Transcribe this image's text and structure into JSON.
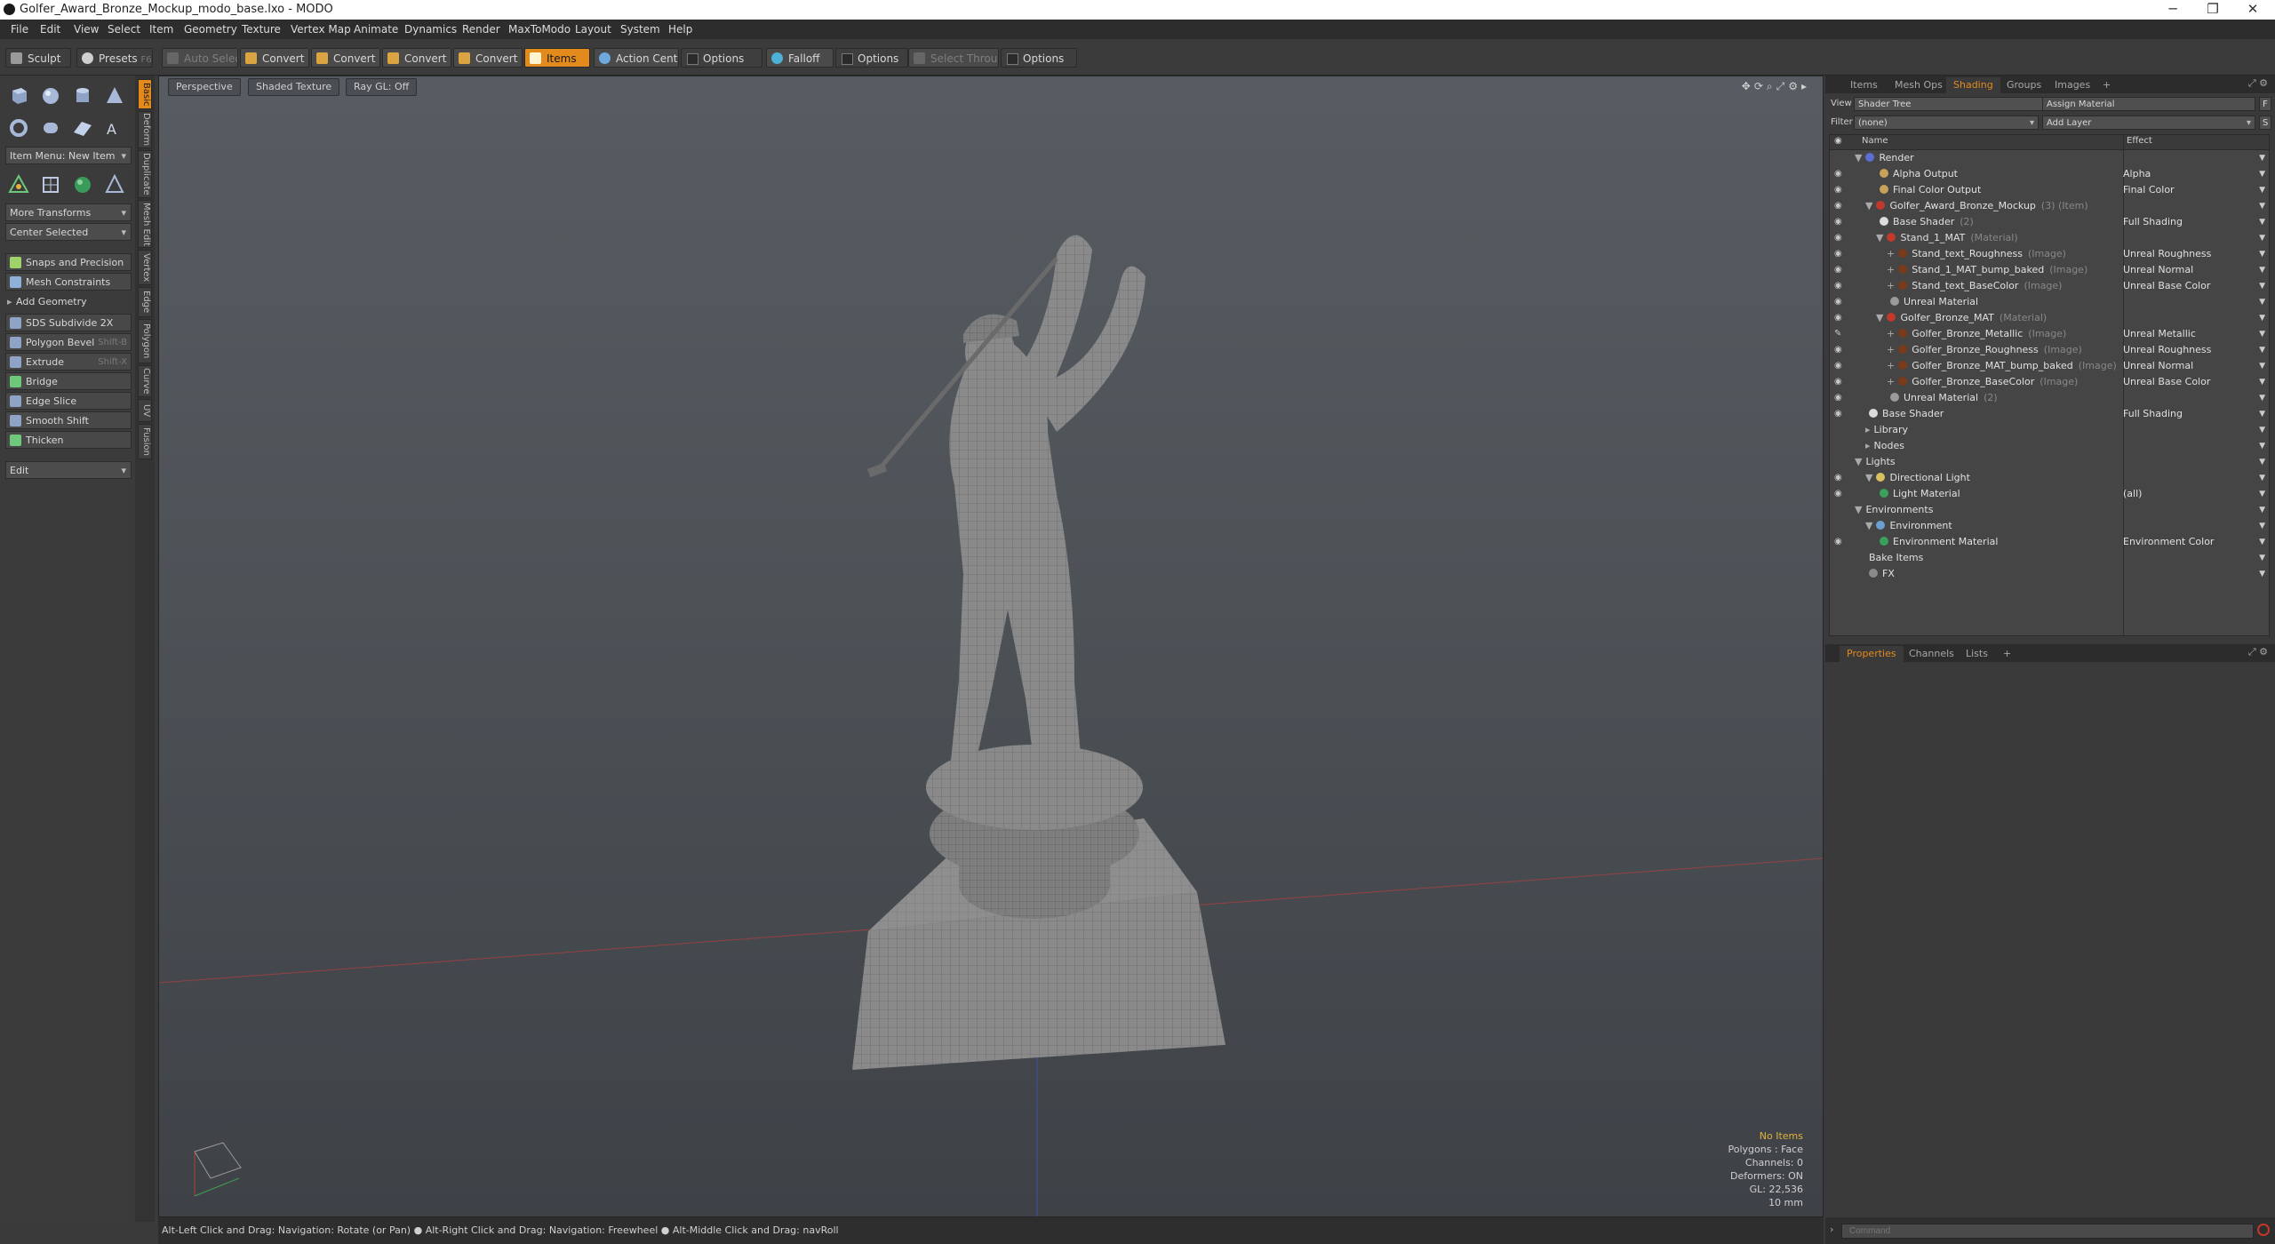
{
  "window": {
    "title": "Golfer_Award_Bronze_Mockup_modo_base.lxo - MODO"
  },
  "menu": [
    "File",
    "Edit",
    "View",
    "Select",
    "Item",
    "Geometry",
    "Texture",
    "Vertex Map",
    "Animate",
    "Dynamics",
    "Render",
    "MaxToModo",
    "Layout",
    "System",
    "Help"
  ],
  "toolbar": {
    "sculpt": "Sculpt",
    "presets": "Presets",
    "presets_key": "F6",
    "auto_select": "Auto Select",
    "convert1": "Convert",
    "convert2": "Convert",
    "convert3": "Convert",
    "convert4": "Convert",
    "items": "Items",
    "action_center": "Action Center",
    "options1": "Options",
    "falloff": "Falloff",
    "options2": "Options",
    "select_through": "Select Through",
    "options3": "Options"
  },
  "left": {
    "item_menu": "Item Menu: New Item",
    "more_transforms": "More Transforms",
    "center_selected": "Center Selected",
    "snaps": "Snaps and Precision",
    "mesh_constraints": "Mesh Constraints",
    "add_geometry": "Add Geometry",
    "sds": "SDS Subdivide 2X",
    "polygon_bevel": "Polygon Bevel",
    "polygon_bevel_key": "Shift-B",
    "extrude": "Extrude",
    "extrude_key": "Shift-X",
    "bridge": "Bridge",
    "edge_slice": "Edge Slice",
    "smooth_shift": "Smooth Shift",
    "thicken": "Thicken",
    "edit": "Edit"
  },
  "vtabs": [
    "Basic",
    "Deform",
    "Duplicate",
    "Mesh Edit",
    "Vertex",
    "Edge",
    "Polygon",
    "Curve",
    "UV",
    "Fusion"
  ],
  "viewport": {
    "perspective": "Perspective",
    "shaded": "Shaded Texture",
    "raygl": "Ray GL: Off",
    "info": {
      "no_items": "No Items",
      "polygons": "Polygons : Face",
      "channels": "Channels: 0",
      "deformers": "Deformers: ON",
      "gl": "GL: 22,536",
      "unit": "10 mm"
    }
  },
  "status": "Alt-Left Click and Drag: Navigation: Rotate (or Pan) ● Alt-Right Click and Drag: Navigation: Freewheel ● Alt-Middle Click and Drag: navRoll",
  "right": {
    "tabs": [
      "Items",
      "Mesh Ops",
      "Shading",
      "Groups",
      "Images",
      "+"
    ],
    "view_label": "View",
    "view_value": "Shader Tree",
    "assign_material": "Assign Material",
    "assign_key": "F",
    "filter_label": "Filter",
    "filter_value": "(none)",
    "add_layer": "Add Layer",
    "add_layer_key": "S",
    "col_name": "Name",
    "col_effect": "Effect",
    "tree": [
      {
        "indent": 0,
        "arrow": "▼",
        "eye": "",
        "icon": "#5a6fd0",
        "name": "Render",
        "type": "",
        "effect": ""
      },
      {
        "indent": 2,
        "arrow": "",
        "eye": "◉",
        "icon": "#c8a25a",
        "name": "Alpha Output",
        "type": "",
        "effect": "Alpha"
      },
      {
        "indent": 2,
        "arrow": "",
        "eye": "◉",
        "icon": "#c8a25a",
        "name": "Final Color Output",
        "type": "",
        "effect": "Final Color"
      },
      {
        "indent": 1,
        "arrow": "▼",
        "eye": "◉",
        "icon": "#c0392b",
        "name": "Golfer_Award_Bronze_Mockup",
        "type": "(3) (Item)",
        "effect": ""
      },
      {
        "indent": 2,
        "arrow": "",
        "eye": "◉",
        "icon": "#dcdcdc",
        "name": "Base Shader",
        "type": "(2)",
        "effect": "Full Shading"
      },
      {
        "indent": 2,
        "arrow": "▼",
        "eye": "◉",
        "icon": "#c0392b",
        "name": "Stand_1_MAT",
        "type": "(Material)",
        "effect": ""
      },
      {
        "indent": 3,
        "arrow": "+",
        "eye": "◉",
        "icon": "#7a3b1c",
        "name": "Stand_text_Roughness",
        "type": "(Image)",
        "effect": "Unreal Roughness"
      },
      {
        "indent": 3,
        "arrow": "+",
        "eye": "◉",
        "icon": "#7a3b1c",
        "name": "Stand_1_MAT_bump_baked",
        "type": "(Image)",
        "effect": "Unreal Normal"
      },
      {
        "indent": 3,
        "arrow": "+",
        "eye": "◉",
        "icon": "#7a3b1c",
        "name": "Stand_text_BaseColor",
        "type": "(Image)",
        "effect": "Unreal Base Color"
      },
      {
        "indent": 3,
        "arrow": "",
        "eye": "◉",
        "icon": "#9a9a9a",
        "name": "Unreal Material",
        "type": "",
        "effect": ""
      },
      {
        "indent": 2,
        "arrow": "▼",
        "eye": "◉",
        "icon": "#c0392b",
        "name": "Golfer_Bronze_MAT",
        "type": "(Material)",
        "effect": ""
      },
      {
        "indent": 3,
        "arrow": "+",
        "eye": "✎",
        "icon": "#7a3b1c",
        "name": "Golfer_Bronze_Metallic",
        "type": "(Image)",
        "effect": "Unreal Metallic"
      },
      {
        "indent": 3,
        "arrow": "+",
        "eye": "◉",
        "icon": "#7a3b1c",
        "name": "Golfer_Bronze_Roughness",
        "type": "(Image)",
        "effect": "Unreal Roughness"
      },
      {
        "indent": 3,
        "arrow": "+",
        "eye": "◉",
        "icon": "#7a3b1c",
        "name": "Golfer_Bronze_MAT_bump_baked",
        "type": "(Image)",
        "effect": "Unreal Normal"
      },
      {
        "indent": 3,
        "arrow": "+",
        "eye": "◉",
        "icon": "#7a3b1c",
        "name": "Golfer_Bronze_BaseColor",
        "type": "(Image)",
        "effect": "Unreal Base Color"
      },
      {
        "indent": 3,
        "arrow": "",
        "eye": "◉",
        "icon": "#9a9a9a",
        "name": "Unreal Material",
        "type": "(2)",
        "effect": ""
      },
      {
        "indent": 1,
        "arrow": "",
        "eye": "◉",
        "icon": "#dcdcdc",
        "name": "Base Shader",
        "type": "",
        "effect": "Full Shading"
      },
      {
        "indent": 1,
        "arrow": "▸",
        "eye": "",
        "icon": "",
        "name": "Library",
        "type": "",
        "effect": ""
      },
      {
        "indent": 1,
        "arrow": "▸",
        "eye": "",
        "icon": "",
        "name": "Nodes",
        "type": "",
        "effect": ""
      },
      {
        "indent": 0,
        "arrow": "▼",
        "eye": "",
        "icon": "",
        "name": "Lights",
        "type": "",
        "effect": ""
      },
      {
        "indent": 1,
        "arrow": "▼",
        "eye": "◉",
        "icon": "#d8c060",
        "name": "Directional Light",
        "type": "",
        "effect": ""
      },
      {
        "indent": 2,
        "arrow": "",
        "eye": "◉",
        "icon": "#3aa05a",
        "name": "Light Material",
        "type": "",
        "effect": "(all)"
      },
      {
        "indent": 0,
        "arrow": "▼",
        "eye": "",
        "icon": "",
        "name": "Environments",
        "type": "",
        "effect": ""
      },
      {
        "indent": 1,
        "arrow": "▼",
        "eye": "",
        "icon": "#6aa0d0",
        "name": "Environment",
        "type": "",
        "effect": ""
      },
      {
        "indent": 2,
        "arrow": "",
        "eye": "◉",
        "icon": "#3aa05a",
        "name": "Environment Material",
        "type": "",
        "effect": "Environment Color"
      },
      {
        "indent": 1,
        "arrow": "",
        "eye": "",
        "icon": "",
        "name": "Bake Items",
        "type": "",
        "effect": ""
      },
      {
        "indent": 1,
        "arrow": "",
        "eye": "",
        "icon": "#8a8a8a",
        "name": "FX",
        "type": "",
        "effect": ""
      }
    ],
    "prop_tabs": [
      "Properties",
      "Channels",
      "Lists",
      "+"
    ],
    "command_placeholder": "Command"
  },
  "colors": {
    "accent": "#e28a1c",
    "panel": "#3a3a3a",
    "menubar": "#2d2d2d"
  }
}
